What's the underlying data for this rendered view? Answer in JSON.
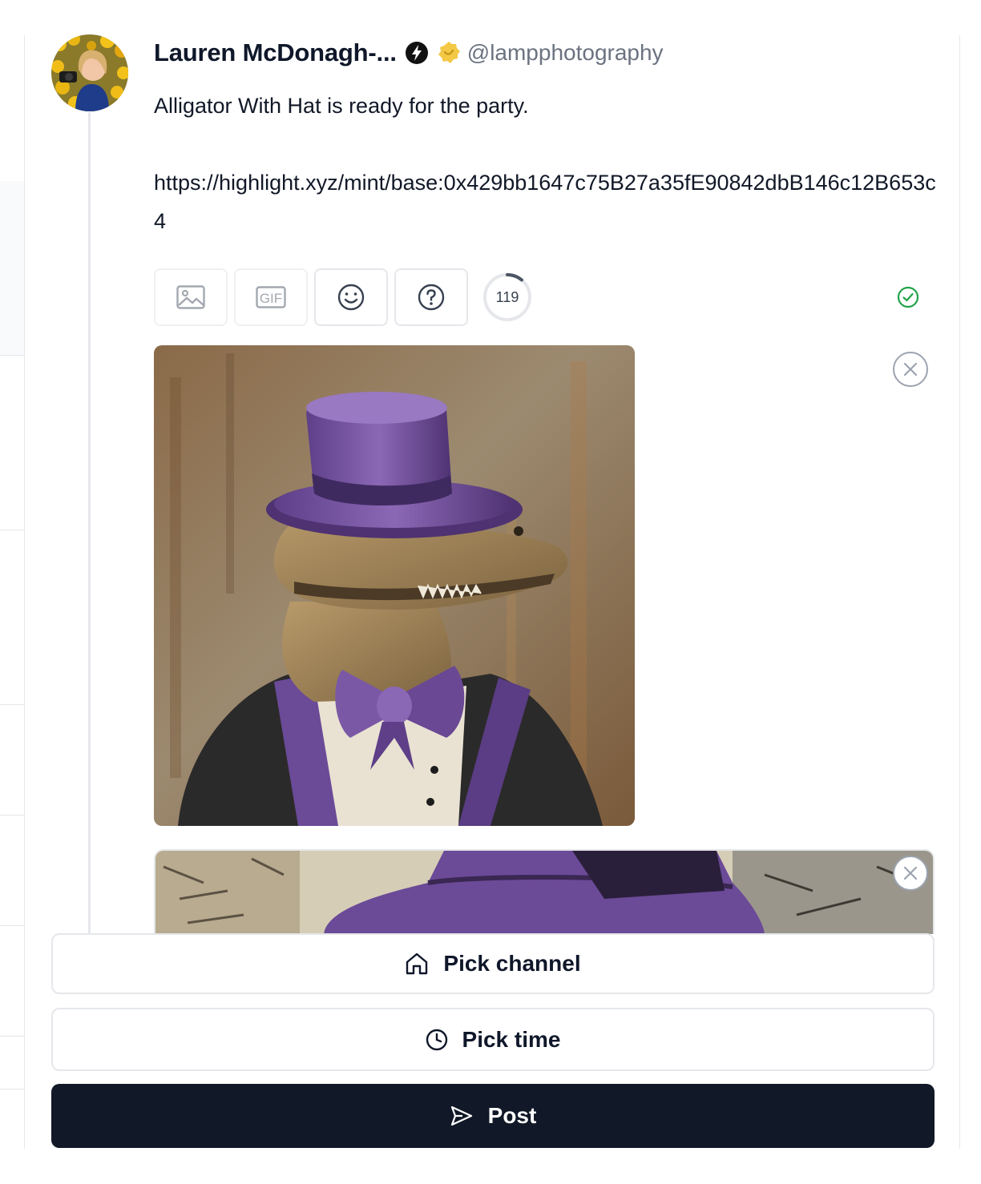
{
  "author": {
    "display_name": "Lauren McDonagh-...",
    "handle": "@lampphotography",
    "avatar": "avatar-photo",
    "badges": [
      "power-badge-icon",
      "yellow-verified-badge-icon"
    ]
  },
  "post": {
    "text": "Alligator With Hat is ready for the party.",
    "url": "https://highlight.xyz/mint/base:0x429bb1647c75B27a35fE90842dbB146c12B653c4"
  },
  "toolbar": {
    "buttons": [
      {
        "name": "image-upload-button",
        "icon": "image-icon"
      },
      {
        "name": "gif-button",
        "icon": "gif-icon",
        "label": "GIF"
      },
      {
        "name": "emoji-button",
        "icon": "smiley-icon"
      },
      {
        "name": "help-button",
        "icon": "question-icon"
      }
    ],
    "char_counter": "119",
    "char_counter_fraction": 0.11,
    "status_icon": "check-circle-icon"
  },
  "actions": {
    "pick_channel": "Pick channel",
    "pick_time": "Pick time",
    "post": "Post"
  },
  "colors": {
    "primary": "#111827",
    "success": "#22a34a",
    "hat_purple": "#7a58a6"
  }
}
